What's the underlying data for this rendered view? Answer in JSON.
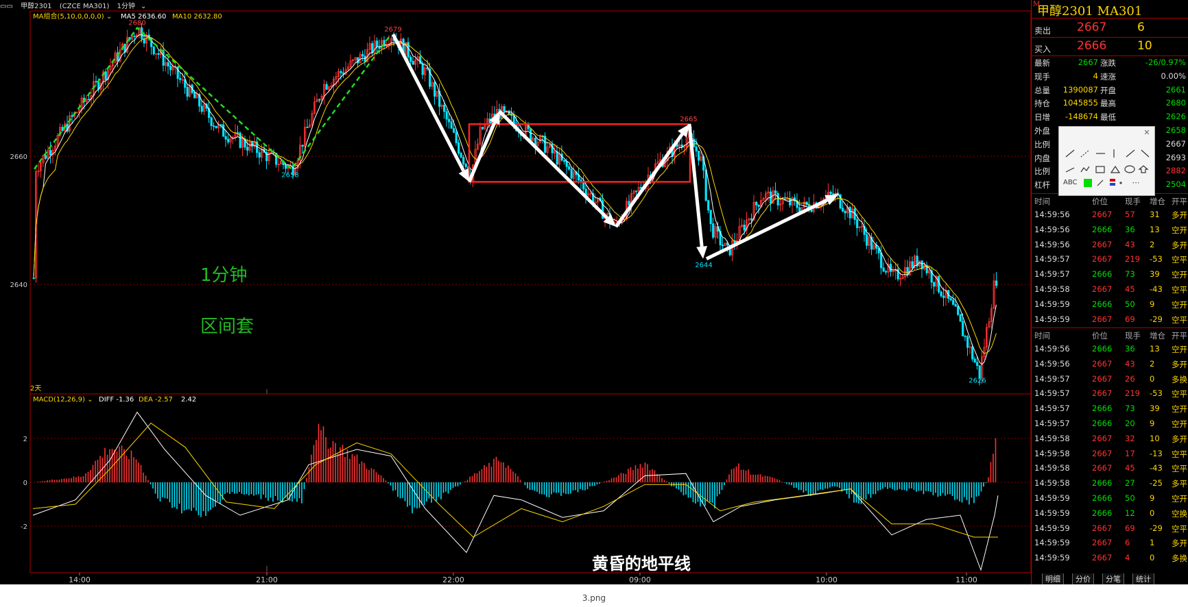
{
  "window": {
    "title": "甲醇2301",
    "m_badge": "M",
    "code": "(CZCE MA301)",
    "period": "1分钟"
  },
  "main_chart": {
    "ma_label": "MA组合(5,10,0,0,0,0)",
    "ma5": "MA5 2636.60",
    "ma10": "MA10 2632.80",
    "y_ticks": [
      "2660",
      "2640"
    ],
    "x_ticks": [
      "14:00",
      "21:00",
      "22:00",
      "09:00",
      "10:00",
      "11:00"
    ],
    "days_label": "2天",
    "notes": [
      "1分钟",
      "区间套"
    ],
    "watermark": "黄昏的地平线",
    "point_labels": [
      "2680",
      "2679",
      "2658",
      "2665",
      "2644",
      "2626"
    ]
  },
  "macd": {
    "label": "MACD(12,26,9)",
    "diff": "DIFF -1.36",
    "dea": "DEA -2.57",
    "macd": "2.42",
    "y_ticks": [
      "2",
      "0",
      "-2"
    ]
  },
  "quote": {
    "title": "甲醇2301  MA301",
    "badge": "M",
    "sell": {
      "label": "卖出",
      "price": "2667",
      "vol": "6"
    },
    "buy": {
      "label": "买入",
      "price": "2666",
      "vol": "10"
    },
    "stats": [
      {
        "k1": "最新",
        "v1": "2667",
        "c1": "grn",
        "k2": "涨跌",
        "v2": "-26/0.97%",
        "c2": "grn"
      },
      {
        "k1": "现手",
        "v1": "4",
        "c1": "yel",
        "k2": "速涨",
        "v2": "0.00%",
        "c2": "wht"
      },
      {
        "k1": "总量",
        "v1": "1390087",
        "c1": "yel",
        "k2": "开盘",
        "v2": "2661",
        "c2": "grn"
      },
      {
        "k1": "持仓",
        "v1": "1045855",
        "c1": "yel",
        "k2": "最高",
        "v2": "2680",
        "c2": "grn"
      },
      {
        "k1": "日增",
        "v1": "-148674",
        "c1": "yel",
        "k2": "最低",
        "v2": "2626",
        "c2": "grn"
      },
      {
        "k1": "外盘",
        "v1": "",
        "c1": "yel",
        "k2": "",
        "v2": "2658",
        "c2": "grn"
      },
      {
        "k1": "比例",
        "v1": "",
        "c1": "yel",
        "k2": "",
        "v2": "2667",
        "c2": "wht"
      },
      {
        "k1": "内盘",
        "v1": "",
        "c1": "yel",
        "k2": "",
        "v2": "2693",
        "c2": "wht"
      },
      {
        "k1": "比例",
        "v1": "",
        "c1": "yel",
        "k2": "",
        "v2": "2882",
        "c2": "red"
      },
      {
        "k1": "杠杆",
        "v1": "",
        "c1": "yel",
        "k2": "",
        "v2": "2504",
        "c2": "grn"
      }
    ],
    "tick_headers": [
      "时间",
      "价位",
      "现手",
      "增仓",
      "开平"
    ],
    "ticks1": [
      [
        "14:59:56",
        "2667",
        "57",
        "31",
        "多开",
        "red",
        "red",
        "yel"
      ],
      [
        "14:59:56",
        "2666",
        "36",
        "13",
        "空开",
        "grn",
        "grn",
        "yel"
      ],
      [
        "14:59:56",
        "2667",
        "43",
        "2",
        "多开",
        "red",
        "red",
        "yel"
      ],
      [
        "14:59:57",
        "2667",
        "219",
        "-53",
        "空平",
        "red",
        "red",
        "yel"
      ],
      [
        "14:59:57",
        "2666",
        "73",
        "39",
        "空开",
        "grn",
        "grn",
        "yel"
      ],
      [
        "14:59:58",
        "2667",
        "45",
        "-43",
        "空平",
        "red",
        "red",
        "yel"
      ],
      [
        "14:59:59",
        "2666",
        "50",
        "9",
        "空开",
        "grn",
        "grn",
        "yel"
      ],
      [
        "14:59:59",
        "2667",
        "69",
        "-29",
        "空平",
        "red",
        "red",
        "yel"
      ]
    ],
    "ticks2": [
      [
        "14:59:56",
        "2666",
        "36",
        "13",
        "空开",
        "grn",
        "grn",
        "yel"
      ],
      [
        "14:59:56",
        "2667",
        "43",
        "2",
        "多开",
        "red",
        "red",
        "yel"
      ],
      [
        "14:59:57",
        "2667",
        "26",
        "0",
        "多换",
        "red",
        "red",
        "yel"
      ],
      [
        "14:59:57",
        "2667",
        "219",
        "-53",
        "空平",
        "red",
        "red",
        "yel"
      ],
      [
        "14:59:57",
        "2666",
        "73",
        "39",
        "空开",
        "grn",
        "grn",
        "yel"
      ],
      [
        "14:59:57",
        "2666",
        "20",
        "9",
        "空开",
        "grn",
        "grn",
        "yel"
      ],
      [
        "14:59:58",
        "2667",
        "32",
        "10",
        "多开",
        "red",
        "red",
        "yel"
      ],
      [
        "14:59:58",
        "2667",
        "17",
        "-13",
        "空平",
        "red",
        "red",
        "yel"
      ],
      [
        "14:59:58",
        "2667",
        "45",
        "-43",
        "空平",
        "red",
        "red",
        "yel"
      ],
      [
        "14:59:58",
        "2666",
        "27",
        "-25",
        "多平",
        "grn",
        "grn",
        "yel"
      ],
      [
        "14:59:59",
        "2666",
        "50",
        "9",
        "空开",
        "grn",
        "grn",
        "yel"
      ],
      [
        "14:59:59",
        "2666",
        "12",
        "0",
        "空换",
        "grn",
        "grn",
        "yel"
      ],
      [
        "14:59:59",
        "2667",
        "69",
        "-29",
        "空平",
        "red",
        "red",
        "yel"
      ],
      [
        "14:59:59",
        "2667",
        "6",
        "1",
        "多开",
        "red",
        "red",
        "yel"
      ],
      [
        "14:59:59",
        "2667",
        "4",
        "0",
        "多换",
        "red",
        "red",
        "yel"
      ]
    ],
    "tabs": [
      "明细",
      "分价",
      "分笔",
      "统计"
    ],
    "toolbar_text": "ABC"
  },
  "file_name": "3.png",
  "colors": {
    "up": "#ff3333",
    "down": "#00e5ff",
    "ma5": "#ffffff",
    "ma10": "#ffd700",
    "green_line": "#22dd22",
    "box": "#ff2020"
  }
}
